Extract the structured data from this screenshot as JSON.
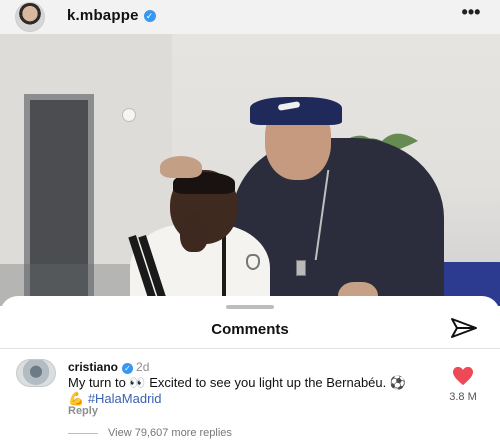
{
  "header": {
    "username": "k.mbappe",
    "verified_icon": "verified-check-icon",
    "more_icon": "more-horizontal-icon",
    "more_glyph": "•••"
  },
  "photo": {
    "subject_icon": "post-photo"
  },
  "comments_sheet": {
    "title": "Comments",
    "send_icon": "send-icon"
  },
  "comment": {
    "username": "cristiano",
    "verified_glyph": "✓",
    "time": "2d",
    "text_part1": "My turn to 👀 Excited to see you light up the Bernabéu. ⚽ 💪 ",
    "hashtag": "#HalaMadrid",
    "reply_label": "Reply",
    "like_count": "3.8 M",
    "like_color": "#ed4956"
  },
  "replies": {
    "label": "View 79,607 more replies"
  },
  "colors": {
    "accent_blue": "#3897f0",
    "hashtag": "#3a5fb0"
  }
}
